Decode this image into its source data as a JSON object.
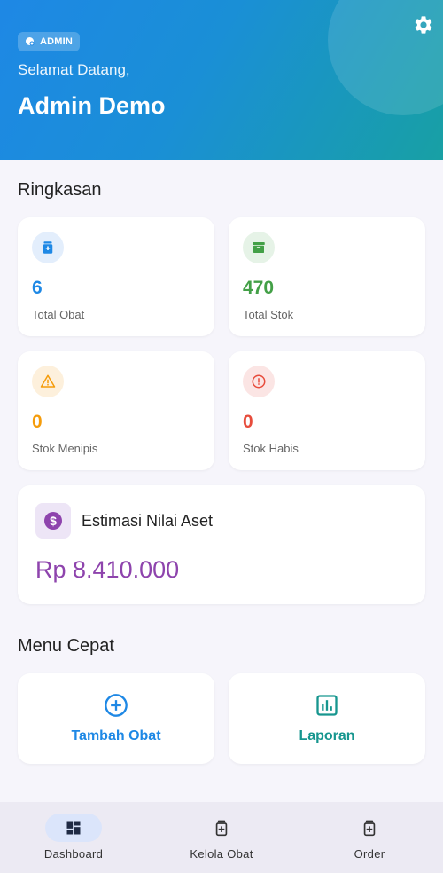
{
  "header": {
    "badge": "ADMIN",
    "welcome": "Selamat Datang,",
    "name": "Admin Demo",
    "settings_icon": "gear-icon"
  },
  "summary": {
    "title": "Ringkasan",
    "stats": [
      {
        "value": "6",
        "label": "Total Obat",
        "icon": "medicine-box-icon",
        "color": "#1e88e5",
        "bg": "#e3eefc"
      },
      {
        "value": "470",
        "label": "Total Stok",
        "icon": "archive-icon",
        "color": "#43a047",
        "bg": "#e6f3e7"
      },
      {
        "value": "0",
        "label": "Stok Menipis",
        "icon": "warning-icon",
        "color": "#f59c0b",
        "bg": "#fdf0dc"
      },
      {
        "value": "0",
        "label": "Stok Habis",
        "icon": "error-icon",
        "color": "#e74c3c",
        "bg": "#fbe5e4"
      }
    ],
    "asset": {
      "title": "Estimasi Nilai Aset",
      "value": "Rp 8.410.000",
      "icon": "dollar-icon",
      "color": "#8e44ad"
    }
  },
  "quick_menu": {
    "title": "Menu Cepat",
    "items": [
      {
        "label": "Tambah Obat",
        "icon": "add-circle-icon",
        "color": "#1e88e5"
      },
      {
        "label": "Laporan",
        "icon": "chart-icon",
        "color": "#17968f"
      }
    ]
  },
  "bottom_nav": {
    "items": [
      {
        "label": "Dashboard",
        "icon": "dashboard-icon",
        "active": true
      },
      {
        "label": "Kelola Obat",
        "icon": "medicine-icon",
        "active": false
      },
      {
        "label": "Order",
        "icon": "medicine-icon",
        "active": false
      }
    ]
  }
}
